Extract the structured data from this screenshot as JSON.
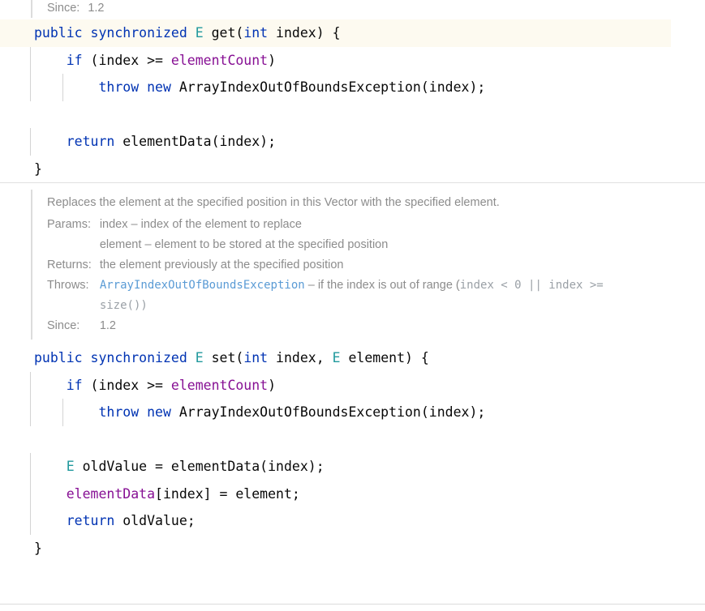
{
  "editor": {
    "language": "java",
    "theme_accent": "#0033b3",
    "highlight_background": "#fdfaf0",
    "field_color": "#871094",
    "type_color": "#20999d",
    "doc_link_color": "#5a9bd5",
    "doc_text_color": "#8c8c8c"
  },
  "top_doc_tail": {
    "since_label": "Since:",
    "since_value": "1.2"
  },
  "get_method": {
    "lines": [
      {
        "id": "sig",
        "highlighted": true,
        "indent": 0,
        "tokens": [
          {
            "t": "public",
            "c": "kw"
          },
          {
            "t": " ",
            "c": "plain"
          },
          {
            "t": "synchronized",
            "c": "kw"
          },
          {
            "t": " ",
            "c": "plain"
          },
          {
            "t": "E",
            "c": "type"
          },
          {
            "t": " get(",
            "c": "plain"
          },
          {
            "t": "int",
            "c": "kw"
          },
          {
            "t": " index) {",
            "c": "plain"
          }
        ]
      },
      {
        "id": "if",
        "highlighted": false,
        "indent": 1,
        "tokens": [
          {
            "t": "if",
            "c": "kw"
          },
          {
            "t": " (index >= ",
            "c": "plain"
          },
          {
            "t": "elementCount",
            "c": "field"
          },
          {
            "t": ")",
            "c": "plain"
          }
        ]
      },
      {
        "id": "throw",
        "highlighted": false,
        "indent": 2,
        "tokens": [
          {
            "t": "throw",
            "c": "kw"
          },
          {
            "t": " ",
            "c": "plain"
          },
          {
            "t": "new",
            "c": "kw"
          },
          {
            "t": " ArrayIndexOutOfBoundsException(index);",
            "c": "plain"
          }
        ]
      },
      {
        "id": "blank1",
        "highlighted": false,
        "indent": 0,
        "tokens": []
      },
      {
        "id": "return",
        "highlighted": false,
        "indent": 1,
        "tokens": [
          {
            "t": "return",
            "c": "kw"
          },
          {
            "t": " elementData(index);",
            "c": "plain"
          }
        ]
      },
      {
        "id": "close",
        "highlighted": false,
        "indent": 0,
        "tokens": [
          {
            "t": "}",
            "c": "plain"
          }
        ]
      }
    ]
  },
  "set_doc": {
    "summary": "Replaces the element at the specified position in this Vector with the specified element.",
    "rows": [
      {
        "label": "Params:",
        "values": [
          {
            "name": "index",
            "dash": "–",
            "desc": "index of the element to replace"
          },
          {
            "name": "element",
            "dash": "–",
            "desc": "element to be stored at the specified position"
          }
        ]
      },
      {
        "label": "Returns:",
        "values": [
          {
            "name": "",
            "dash": "",
            "desc": "the element previously at the specified position"
          }
        ]
      },
      {
        "label": "Throws:",
        "link": "ArrayIndexOutOfBoundsException",
        "dash": "–",
        "desc_before": "if the index is out of range (",
        "code_inline": "index < 0 || index >=",
        "desc_wrap_code": "size())"
      },
      {
        "label": "Since:",
        "values": [
          {
            "name": "",
            "dash": "",
            "desc": "1.2"
          }
        ]
      }
    ]
  },
  "set_method": {
    "lines": [
      {
        "id": "sig",
        "highlighted": false,
        "indent": 0,
        "tokens": [
          {
            "t": "public",
            "c": "kw"
          },
          {
            "t": " ",
            "c": "plain"
          },
          {
            "t": "synchronized",
            "c": "kw"
          },
          {
            "t": " ",
            "c": "plain"
          },
          {
            "t": "E",
            "c": "type"
          },
          {
            "t": " set(",
            "c": "plain"
          },
          {
            "t": "int",
            "c": "kw"
          },
          {
            "t": " index, ",
            "c": "plain"
          },
          {
            "t": "E",
            "c": "type"
          },
          {
            "t": " element) {",
            "c": "plain"
          }
        ]
      },
      {
        "id": "if",
        "highlighted": false,
        "indent": 1,
        "tokens": [
          {
            "t": "if",
            "c": "kw"
          },
          {
            "t": " (index >= ",
            "c": "plain"
          },
          {
            "t": "elementCount",
            "c": "field"
          },
          {
            "t": ")",
            "c": "plain"
          }
        ]
      },
      {
        "id": "throw",
        "highlighted": false,
        "indent": 2,
        "tokens": [
          {
            "t": "throw",
            "c": "kw"
          },
          {
            "t": " ",
            "c": "plain"
          },
          {
            "t": "new",
            "c": "kw"
          },
          {
            "t": " ArrayIndexOutOfBoundsException(index);",
            "c": "plain"
          }
        ]
      },
      {
        "id": "blank1",
        "highlighted": false,
        "indent": 0,
        "tokens": []
      },
      {
        "id": "oldvalue",
        "highlighted": false,
        "indent": 1,
        "tokens": [
          {
            "t": "E",
            "c": "type"
          },
          {
            "t": " oldValue = elementData(index);",
            "c": "plain"
          }
        ]
      },
      {
        "id": "assign",
        "highlighted": false,
        "indent": 1,
        "tokens": [
          {
            "t": "elementData",
            "c": "field"
          },
          {
            "t": "[index] = element;",
            "c": "plain"
          }
        ]
      },
      {
        "id": "return",
        "highlighted": false,
        "indent": 1,
        "tokens": [
          {
            "t": "return",
            "c": "kw"
          },
          {
            "t": " oldValue;",
            "c": "plain"
          }
        ]
      },
      {
        "id": "close",
        "highlighted": false,
        "indent": 0,
        "tokens": [
          {
            "t": "}",
            "c": "plain"
          }
        ]
      }
    ]
  }
}
